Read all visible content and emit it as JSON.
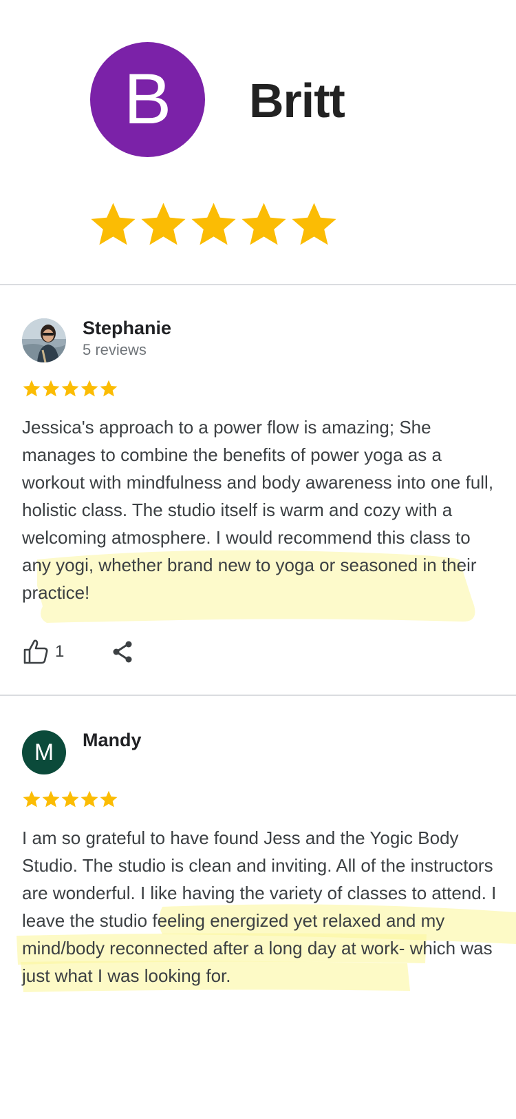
{
  "header": {
    "avatar_letter": "B",
    "avatar_color": "#7b22a8",
    "name": "Britt",
    "rating": 5,
    "star_color": "#fbbc04"
  },
  "reviews": [
    {
      "name": "Stephanie",
      "meta": "5 reviews",
      "avatar_type": "photo",
      "rating": 5,
      "text": "Jessica's approach to a power flow is amazing; She manages to combine the benefits of power yoga as a workout with mindfulness and body awareness into one full, holistic class. The studio itself is warm and cozy with a welcoming atmosphere. I would recommend this class to any yogi, whether brand new to yoga or seasoned in their practice!",
      "like_count": "1",
      "icons": [
        "thumbs-up-icon",
        "share-icon"
      ]
    },
    {
      "name": "Mandy",
      "avatar_letter": "M",
      "avatar_color": "#0b4a3a",
      "rating": 5,
      "text": "I am so grateful to have found Jess and the Yogic Body Studio. The studio is clean and inviting. All of the instructors are wonderful. I like having the variety of classes to attend. I leave the studio feeling energized yet relaxed and my mind/body reconnected after a long day at work- which was just what I was looking for."
    }
  ],
  "highlight_color": "#fbf6a0"
}
